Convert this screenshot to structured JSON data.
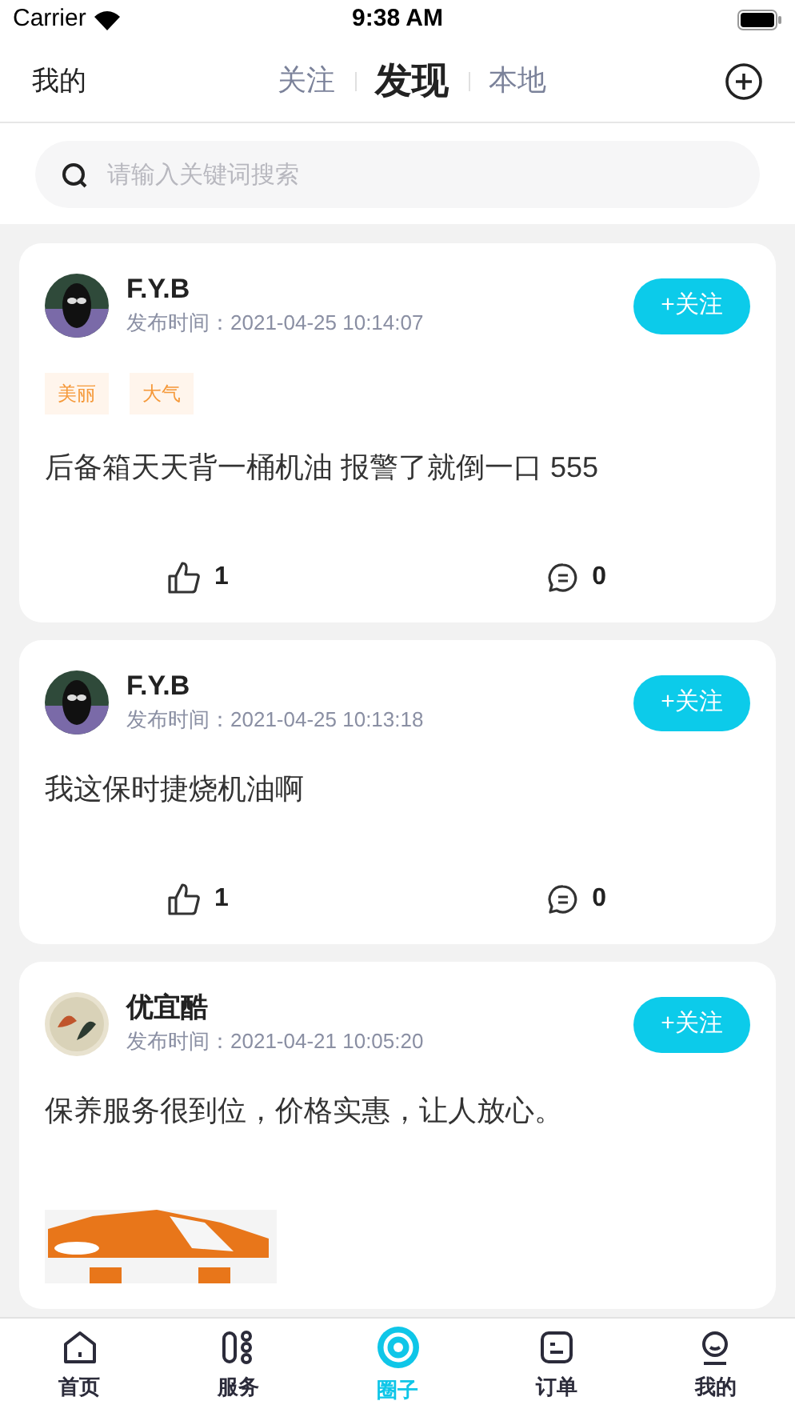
{
  "status_bar": {
    "carrier": "Carrier",
    "time": "9:38 AM"
  },
  "header": {
    "left": "我的",
    "tabs": [
      {
        "label": "关注",
        "selected": false
      },
      {
        "label": "发现",
        "selected": true
      },
      {
        "label": "本地",
        "selected": false
      }
    ]
  },
  "search": {
    "placeholder": "请输入关键词搜索"
  },
  "posts": [
    {
      "author": "F.Y.B",
      "time": "发布时间：2021-04-25 10:14:07",
      "follow": "+关注",
      "tags": [
        "美丽",
        "大气"
      ],
      "text": "后备箱天天背一桶机油  报警了就倒一口 555",
      "likes": "1",
      "comments": "0"
    },
    {
      "author": "F.Y.B",
      "time": "发布时间：2021-04-25 10:13:18",
      "follow": "+关注",
      "text": "我这保时捷烧机油啊",
      "likes": "1",
      "comments": "0"
    },
    {
      "author": "优宜酷",
      "time": "发布时间：2021-04-21 10:05:20",
      "follow": "+关注",
      "text": "保养服务很到位，价格实惠，让人放心。"
    }
  ],
  "tab_bar": [
    {
      "label": "首页",
      "selected": false
    },
    {
      "label": "服务",
      "selected": false
    },
    {
      "label": "圈子",
      "selected": true
    },
    {
      "label": "订单",
      "selected": false
    },
    {
      "label": "我的",
      "selected": false
    }
  ]
}
